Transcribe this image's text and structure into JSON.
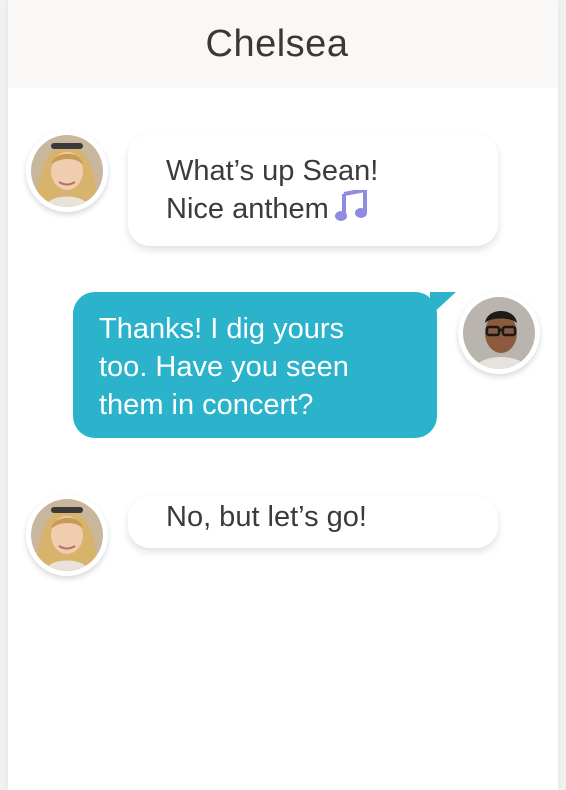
{
  "header": {
    "title": "Chelsea"
  },
  "messages": [
    {
      "sender": "Chelsea",
      "direction": "incoming",
      "text": "What’s up Sean!\nNice anthem",
      "emoji": "musical-note-icon"
    },
    {
      "sender": "Sean",
      "direction": "outgoing",
      "text": "Thanks! I dig yours\ntoo. Have you seen\nthem in concert?"
    },
    {
      "sender": "Chelsea",
      "direction": "incoming",
      "text": "No, but let’s go!"
    }
  ],
  "colors": {
    "outgoing_bubble": "#2bb3cc",
    "incoming_bubble": "#ffffff",
    "header_bg": "#f9f8f6",
    "text_dark": "#3d3a3a",
    "emoji": "#8e8be0"
  }
}
